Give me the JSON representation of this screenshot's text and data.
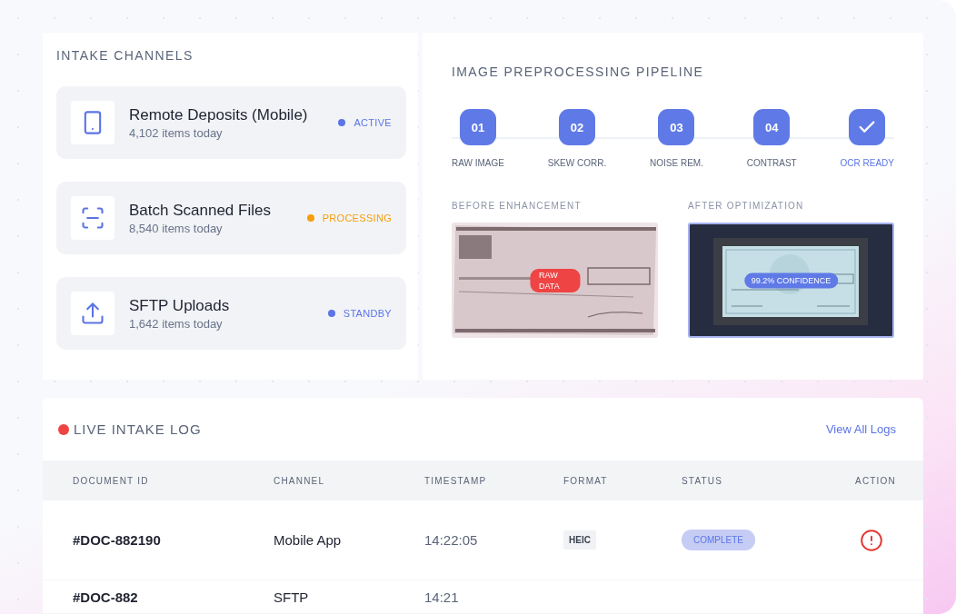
{
  "intake": {
    "title": "INTAKE CHANNELS",
    "channels": [
      {
        "kind": "phone",
        "name": "Remote Deposits (Mobile)",
        "count": "4,102 items today",
        "status": "ACTIVE",
        "color": "#5b74e6"
      },
      {
        "kind": "scan",
        "name": "Batch Scanned Files",
        "count": "8,540 items today",
        "status": "PROCESSING",
        "color": "#f59e0b"
      },
      {
        "kind": "upload",
        "name": "SFTP Uploads",
        "count": "1,642 items today",
        "status": "STANDBY",
        "color": "#5b74e6"
      }
    ]
  },
  "pipeline": {
    "title": "IMAGE PREPROCESSING PIPELINE",
    "steps": [
      {
        "kind": "number",
        "number": "01",
        "label": "RAW IMAGE"
      },
      {
        "kind": "number",
        "number": "02",
        "label": "SKEW CORR."
      },
      {
        "kind": "number",
        "number": "03",
        "label": "NOISE REM."
      },
      {
        "kind": "number",
        "number": "04",
        "label": "CONTRAST"
      },
      {
        "kind": "check",
        "label": "OCR READY"
      }
    ],
    "previews": [
      {
        "kind": "before",
        "label": "BEFORE ENHANCEMENT",
        "badge": "RAW DATA"
      },
      {
        "kind": "after",
        "label": "AFTER OPTIMIZATION",
        "badge": "99.2% CONFIDENCE"
      }
    ]
  },
  "log": {
    "title": "LIVE INTAKE LOG",
    "link": "View All Logs",
    "columns": [
      "DOCUMENT ID",
      "CHANNEL",
      "TIMESTAMP",
      "FORMAT",
      "STATUS",
      "ACTION"
    ],
    "rows": [
      {
        "id": "#DOC-882190",
        "channel": "Mobile App",
        "time": "14:22:05",
        "format": "HEIC",
        "status": "COMPLETE"
      },
      {
        "id": "#DOC-882",
        "channel": "SFTP",
        "time": "14:21"
      }
    ]
  }
}
